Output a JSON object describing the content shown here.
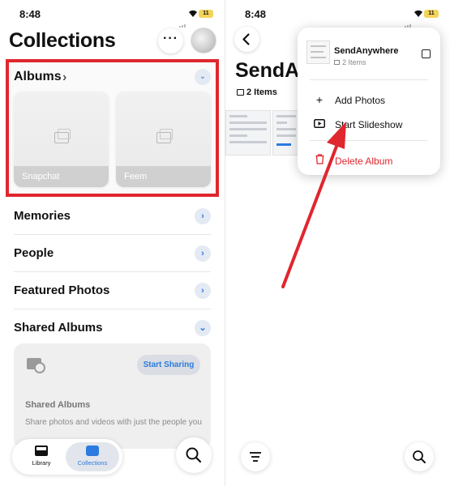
{
  "status_bar": {
    "time": "8:48",
    "battery": "11"
  },
  "collections": {
    "title": "Collections",
    "albums": {
      "heading": "Albums",
      "items": [
        {
          "label": "Snapchat"
        },
        {
          "label": "Feem"
        }
      ]
    },
    "rows": [
      {
        "label": "Memories"
      },
      {
        "label": "People"
      },
      {
        "label": "Featured Photos"
      },
      {
        "label": "Shared Albums"
      }
    ],
    "shared_card": {
      "button_label": "Start Sharing",
      "heading": "Shared Albums",
      "description": "Share photos and videos with just the people you"
    },
    "tab_bar": {
      "tabs": [
        {
          "label": "Library"
        },
        {
          "label": "Collections",
          "selected": true
        }
      ]
    }
  },
  "album_view": {
    "title": "SendA",
    "count": "2 Items",
    "menu": {
      "album_name": "SendAnywhere",
      "album_count": "2 Items",
      "items": [
        {
          "label": "Add Photos",
          "icon": "plus-icon"
        },
        {
          "label": "Start Slideshow",
          "icon": "play-icon"
        },
        {
          "label": "Delete Album",
          "icon": "trash-icon",
          "color": "#e0262e"
        }
      ]
    }
  },
  "colors": {
    "accent": "#2b7be0",
    "highlight": "#e0262e"
  }
}
